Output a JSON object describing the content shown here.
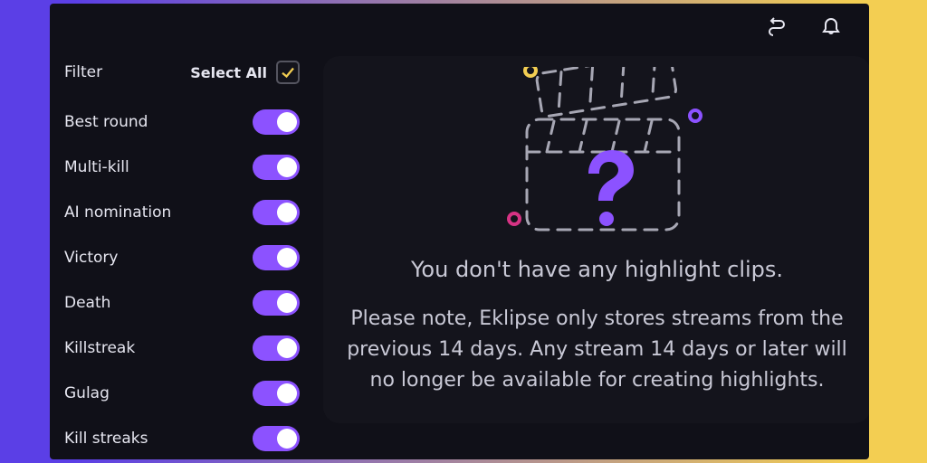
{
  "topbar": {
    "action_icon": "routing-icon",
    "notification_icon": "bell-icon"
  },
  "sidebar": {
    "filter_title": "Filter",
    "select_all_label": "Select All",
    "select_all_checked": true,
    "items": [
      {
        "label": "Best round",
        "on": true
      },
      {
        "label": "Multi-kill",
        "on": true
      },
      {
        "label": "AI nomination",
        "on": true
      },
      {
        "label": "Victory",
        "on": true
      },
      {
        "label": "Death",
        "on": true
      },
      {
        "label": "Killstreak",
        "on": true
      },
      {
        "label": "Gulag",
        "on": true
      },
      {
        "label": "Kill streaks",
        "on": true
      }
    ]
  },
  "main": {
    "empty_title": "You don't have any highlight clips.",
    "empty_body": "Please note, Eklipse only stores streams from the previous 14 days. Any stream 14 days or later will no longer be available for creating highlights."
  },
  "colors": {
    "accent": "#8c52ff",
    "frame_left": "#5b3fe6",
    "frame_right": "#f3ce52"
  }
}
